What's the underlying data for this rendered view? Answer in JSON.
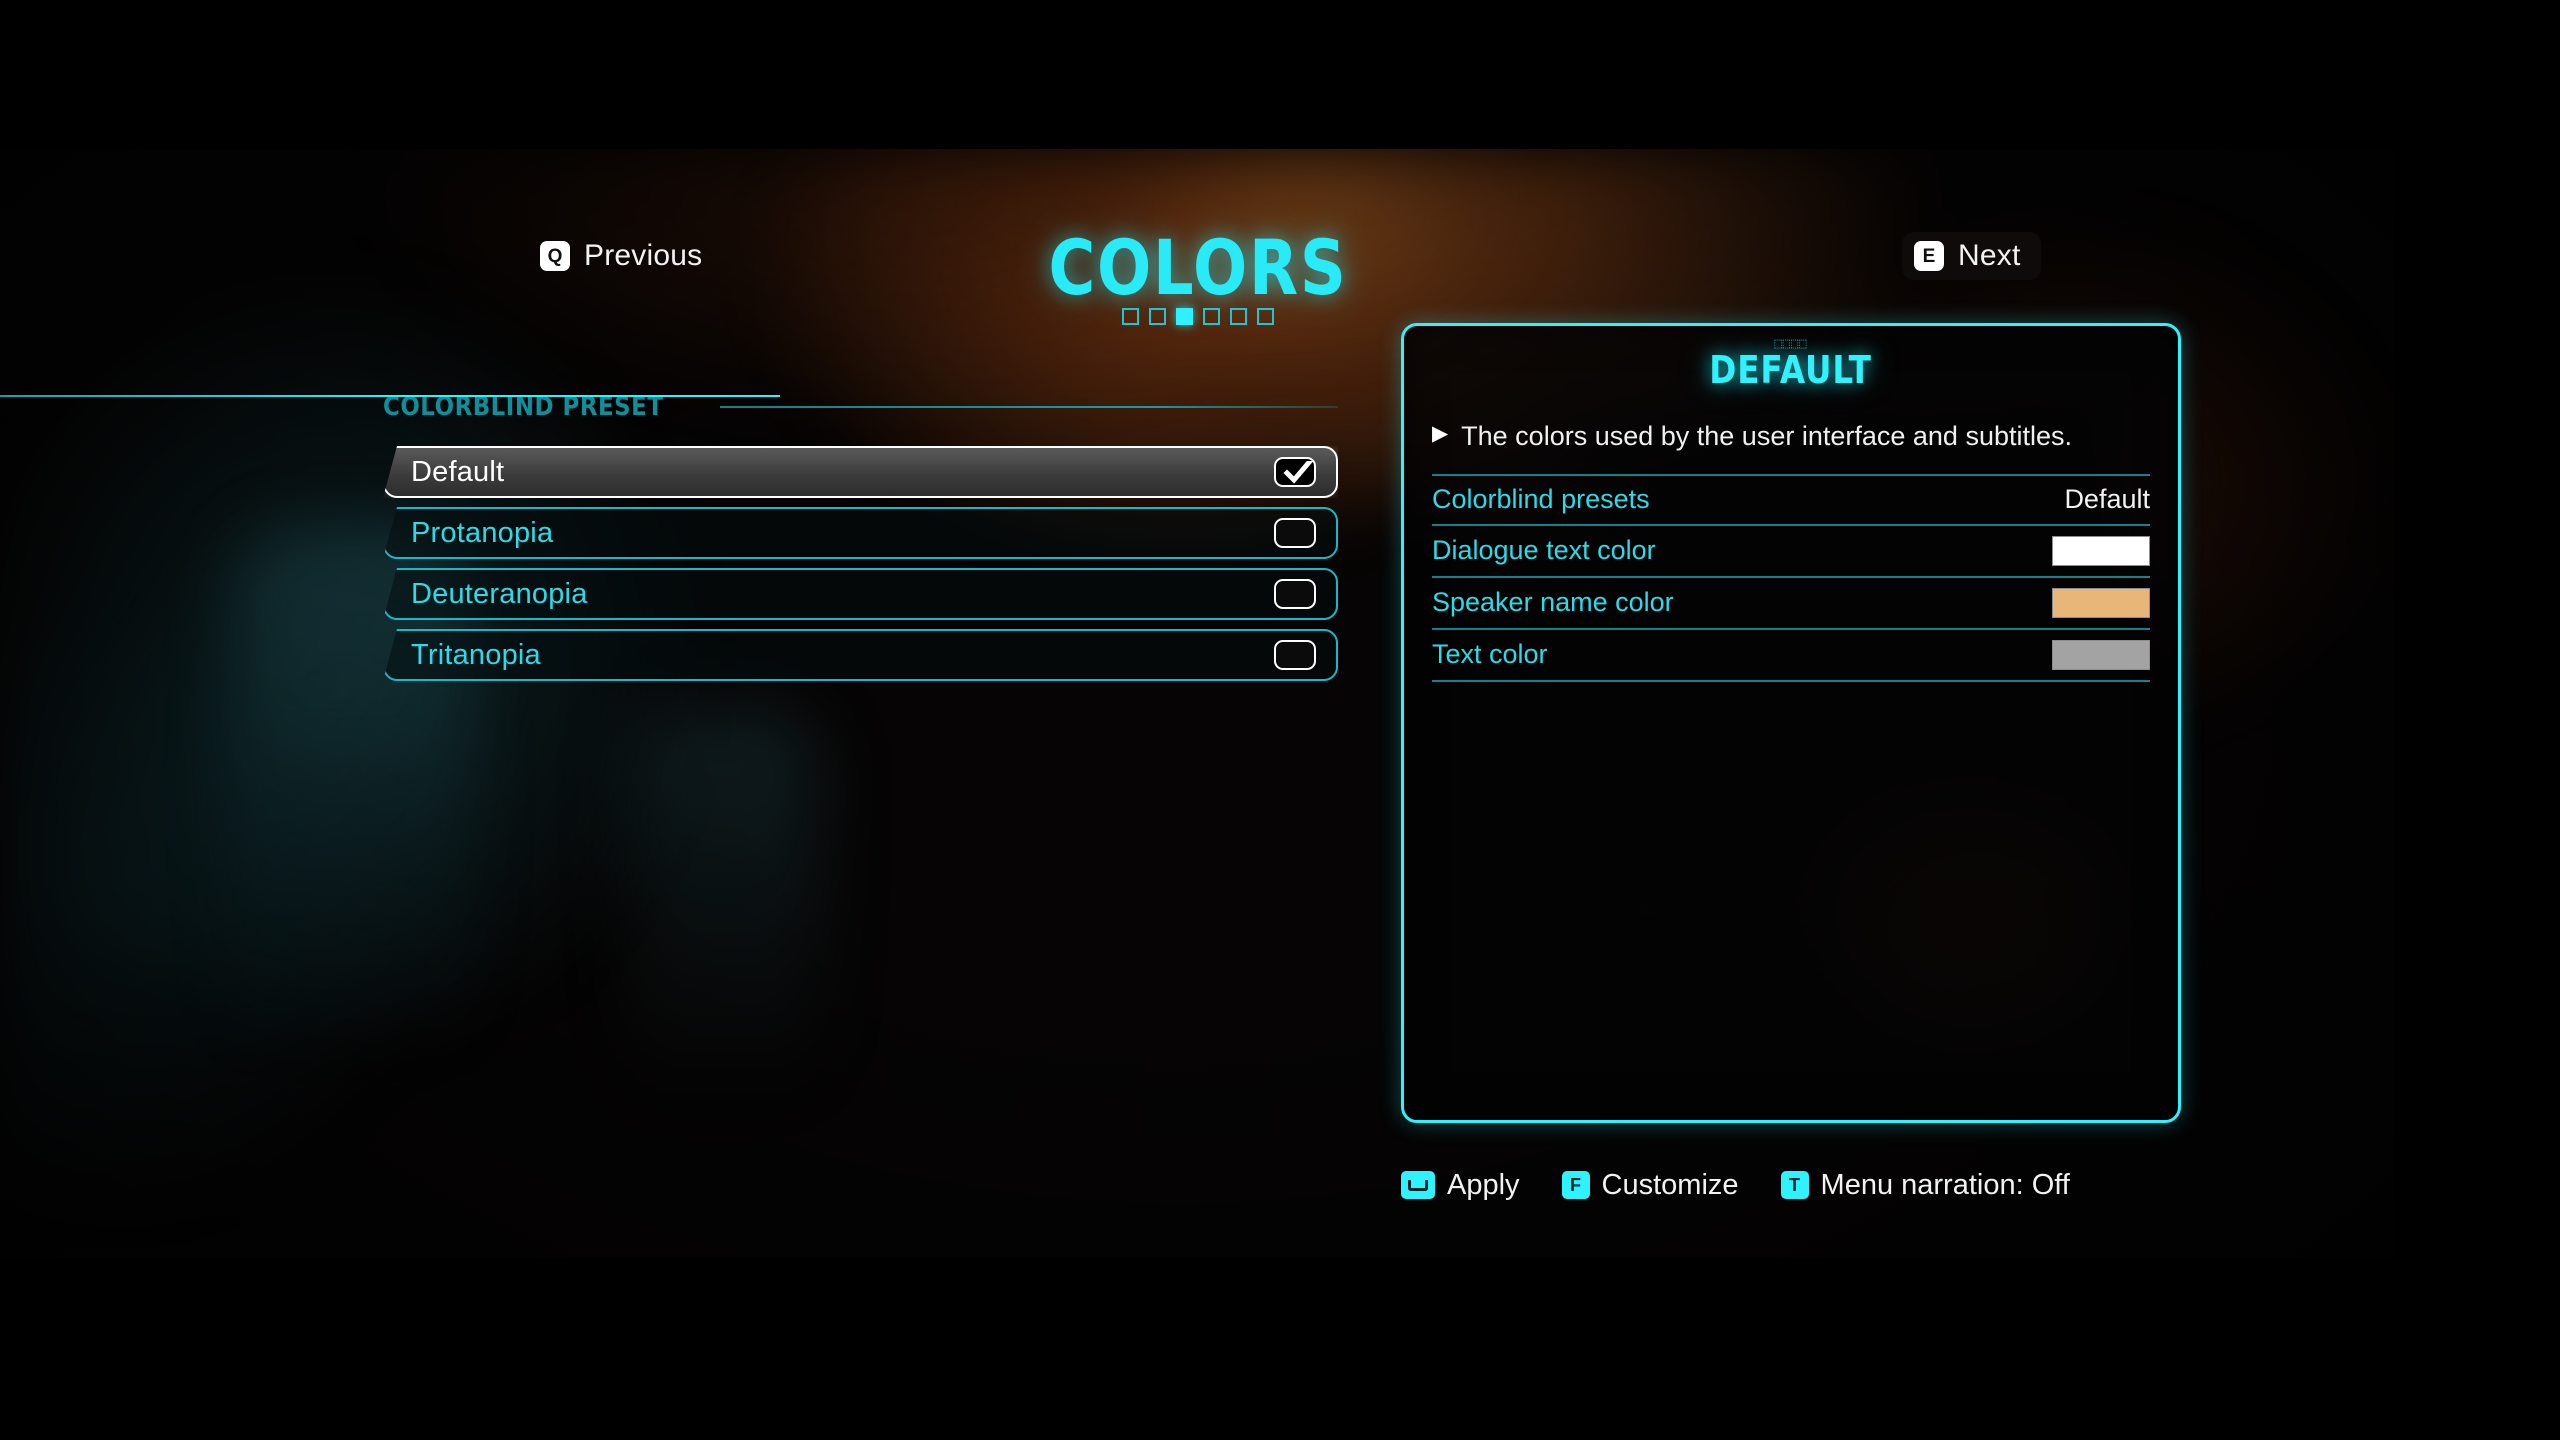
{
  "nav": {
    "previous": {
      "key": "Q",
      "label": "Previous"
    },
    "next": {
      "key": "E",
      "label": "Next"
    }
  },
  "header": {
    "title": "COLORS",
    "pages": {
      "total": 6,
      "current": 3
    }
  },
  "left_section": {
    "heading": "COLORBLIND PRESET",
    "options": [
      {
        "label": "Default",
        "selected": true
      },
      {
        "label": "Protanopia",
        "selected": false
      },
      {
        "label": "Deuteranopia",
        "selected": false
      },
      {
        "label": "Tritanopia",
        "selected": false
      }
    ]
  },
  "detail_panel": {
    "glyph": "⬚⬚⬚⬚",
    "title": "DEFAULT",
    "description": "The colors used by the user interface and subtitles.",
    "rows": [
      {
        "label": "Colorblind presets",
        "value": "Default",
        "type": "text"
      },
      {
        "label": "Dialogue text color",
        "type": "swatch",
        "color": "#FFFFFF"
      },
      {
        "label": "Speaker name color",
        "type": "swatch",
        "color": "#E8B678"
      },
      {
        "label": "Text color",
        "type": "swatch",
        "color": "#A3A3A3"
      }
    ]
  },
  "bottom_bar": [
    {
      "key": "space",
      "label": "Apply"
    },
    {
      "key": "F",
      "label": "Customize"
    },
    {
      "key": "T",
      "label": "Menu narration: Off"
    }
  ],
  "theme": {
    "accent_cyan": "#2FF2FF",
    "accent_teal": "#0F8F9C",
    "text_light": "#F2F2F2"
  }
}
